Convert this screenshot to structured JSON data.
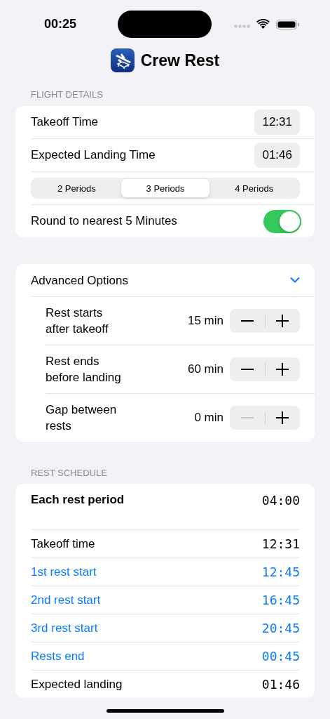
{
  "status_bar": {
    "time": "00:25"
  },
  "app": {
    "title": "Crew Rest"
  },
  "flight_details": {
    "header": "FLIGHT DETAILS",
    "times": [
      {
        "label": "Takeoff Time",
        "value": "12:31"
      },
      {
        "label": "Expected Landing Time",
        "value": "01:46"
      }
    ],
    "segments": [
      {
        "label": "2 Periods",
        "selected": false
      },
      {
        "label": "3 Periods",
        "selected": true
      },
      {
        "label": "4 Periods",
        "selected": false
      }
    ],
    "toggle": {
      "label": "Round to nearest 5 Minutes",
      "on": true
    }
  },
  "advanced": {
    "title": "Advanced Options",
    "expanded": true,
    "steppers": [
      {
        "label": "Rest starts\nafter takeoff",
        "value": "15 min",
        "minus_disabled": false
      },
      {
        "label": "Rest ends\nbefore landing",
        "value": "60 min",
        "minus_disabled": false
      },
      {
        "label": "Gap between\nrests",
        "value": "0 min",
        "minus_disabled": true
      }
    ]
  },
  "schedule": {
    "header": "REST SCHEDULE",
    "summary": {
      "label": "Each rest period",
      "value": "04:00"
    },
    "rows": [
      {
        "label": "Takeoff time",
        "value": "12:31",
        "highlighted": false
      },
      {
        "label": "1st rest start",
        "value": "12:45",
        "highlighted": true
      },
      {
        "label": "2nd rest start",
        "value": "16:45",
        "highlighted": true
      },
      {
        "label": "3rd rest start",
        "value": "20:45",
        "highlighted": true
      },
      {
        "label": "Rests end",
        "value": "00:45",
        "highlighted": true
      },
      {
        "label": "Expected landing",
        "value": "01:46",
        "highlighted": false
      }
    ]
  }
}
